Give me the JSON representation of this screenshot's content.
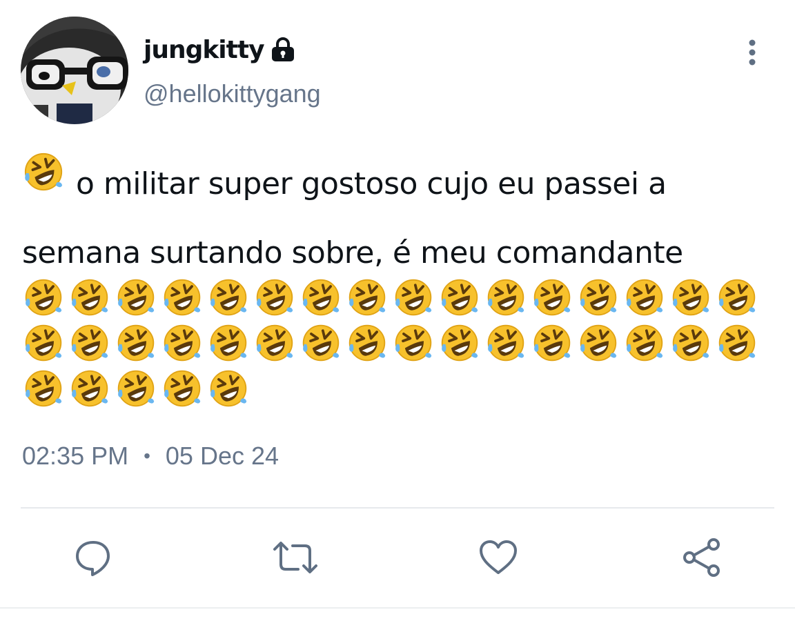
{
  "user": {
    "display_name": "jungkitty",
    "handle": "@hellokittygang",
    "protected": true
  },
  "tweet": {
    "text": "o militar super gostoso cujo eu passei a semana surtando sobre, é meu comandante",
    "lead_emoji": "rolling-on-the-floor-laughing",
    "trailing_emoji": "rolling-on-the-floor-laughing",
    "trailing_emoji_count": 37,
    "time": "02:35 PM",
    "separator": "•",
    "date": "05 Dec 24"
  },
  "actions": [
    {
      "name": "reply",
      "icon": "comment-icon"
    },
    {
      "name": "retweet",
      "icon": "retweet-icon"
    },
    {
      "name": "like",
      "icon": "heart-icon"
    },
    {
      "name": "share",
      "icon": "share-icon"
    }
  ],
  "colors": {
    "text": "#0f1419",
    "secondary": "#66758a",
    "icon": "#5f6f83",
    "divider": "#e6e9ec"
  }
}
